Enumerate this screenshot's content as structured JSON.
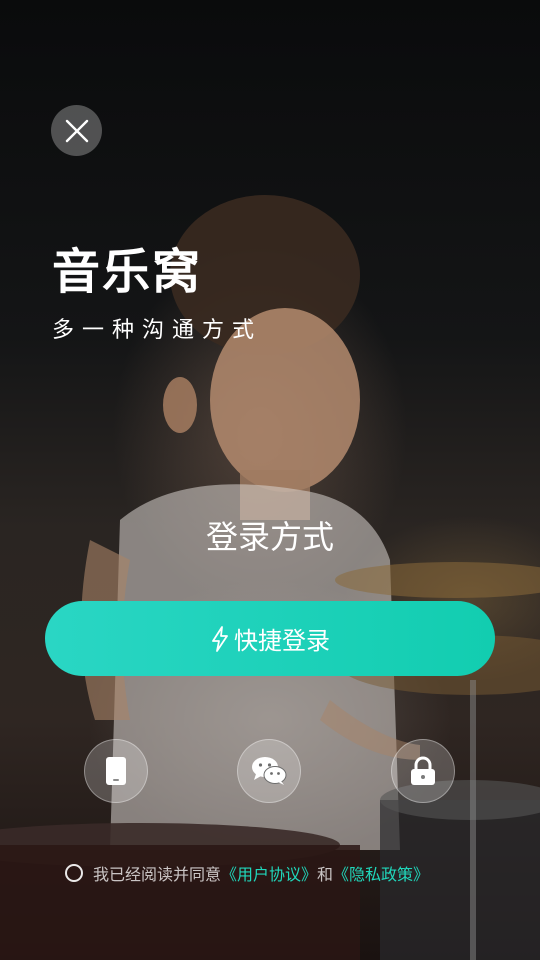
{
  "header": {
    "close_icon": "close-icon"
  },
  "app": {
    "title": "音乐窝",
    "slogan": "多一种沟通方式"
  },
  "login": {
    "heading": "登录方式",
    "quick_login_label": "快捷登录",
    "quick_login_icon": "lightning-icon",
    "accent_color": "#1ad3b8",
    "methods": [
      {
        "name": "phone",
        "icon": "phone-icon"
      },
      {
        "name": "wechat",
        "icon": "wechat-icon"
      },
      {
        "name": "password",
        "icon": "lock-icon"
      }
    ]
  },
  "agreement": {
    "prefix": "我已经阅读并同意",
    "user_agreement": "《用户协议》",
    "conjunction": "和",
    "privacy_policy": "《隐私政策》"
  }
}
